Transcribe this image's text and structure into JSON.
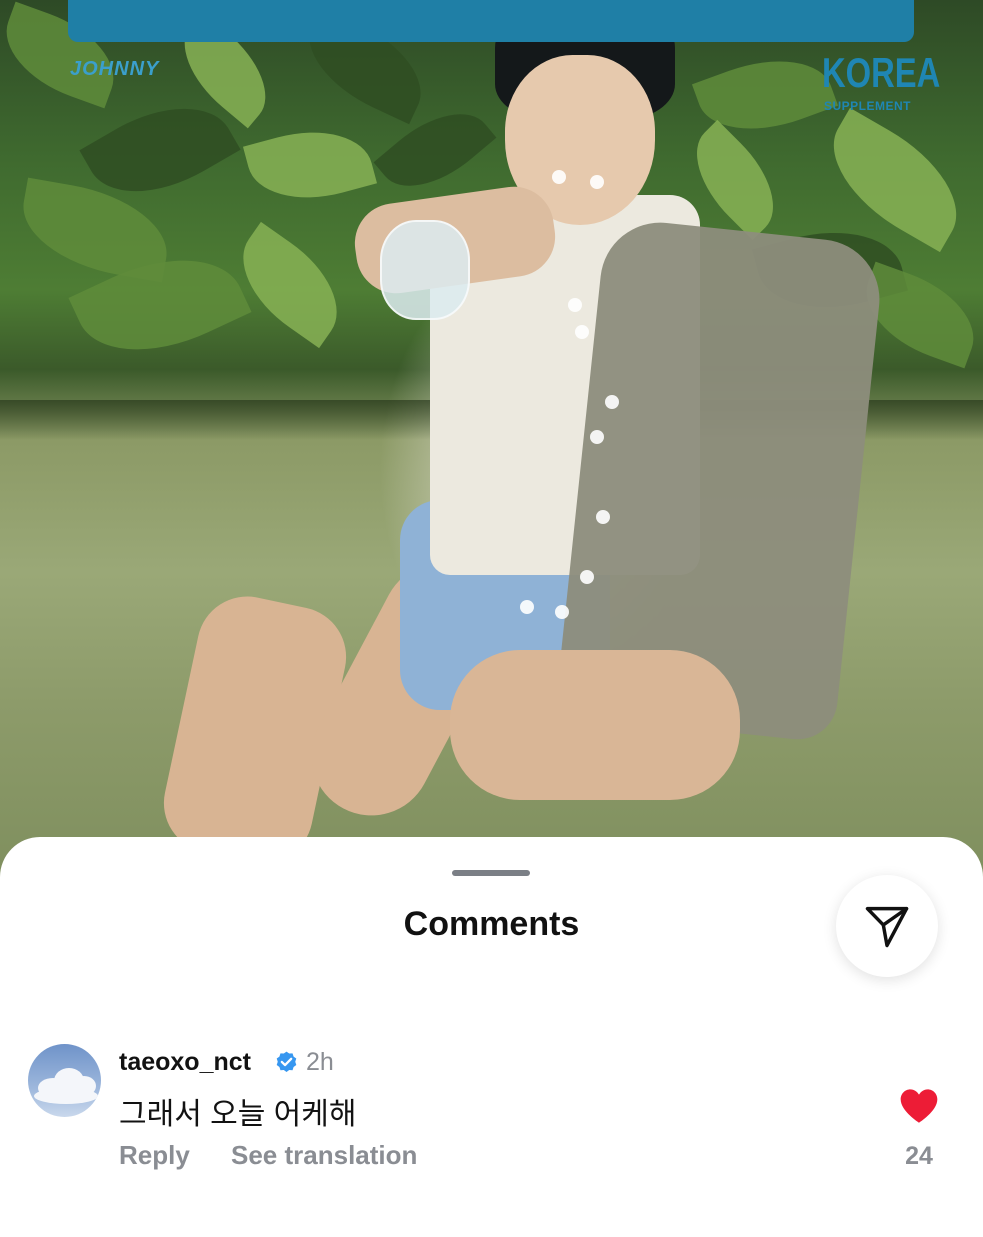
{
  "photo": {
    "masthead_small": "JOHNNY",
    "masthead_korea": "KOREA",
    "masthead_supplement": "SUPPLEMENT",
    "brand_color": "#1f7fa6"
  },
  "sheet": {
    "title": "Comments",
    "share_icon": "paper-plane-icon"
  },
  "comment": {
    "username": "taeoxo_nct",
    "verified": true,
    "time": "2h",
    "text": "그래서 오늘 어케해",
    "reply_label": "Reply",
    "translate_label": "See translation",
    "likes": "24",
    "liked": true,
    "heart_color": "#ed1c36",
    "verified_color": "#3797f0"
  }
}
